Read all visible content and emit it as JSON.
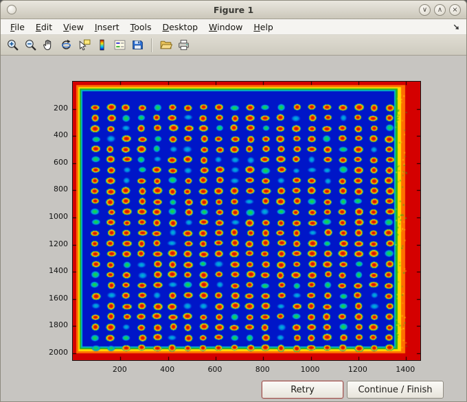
{
  "window": {
    "title": "Figure 1",
    "controls": [
      {
        "name": "minimize",
        "glyph": "∨"
      },
      {
        "name": "maximize",
        "glyph": "∧"
      },
      {
        "name": "close",
        "glyph": "×"
      }
    ]
  },
  "menubar": {
    "items": [
      {
        "label": "File"
      },
      {
        "label": "Edit"
      },
      {
        "label": "View"
      },
      {
        "label": "Insert"
      },
      {
        "label": "Tools"
      },
      {
        "label": "Desktop"
      },
      {
        "label": "Window"
      },
      {
        "label": "Help"
      }
    ]
  },
  "toolbar": {
    "buttons": [
      {
        "name": "zoom-in",
        "title": "Zoom In"
      },
      {
        "name": "zoom-out",
        "title": "Zoom Out"
      },
      {
        "name": "pan",
        "title": "Pan"
      },
      {
        "name": "rotate-3d",
        "title": "Rotate 3D"
      },
      {
        "name": "data-cursor",
        "title": "Data Cursor"
      },
      {
        "name": "insert-colorbar",
        "title": "Insert Colorbar"
      },
      {
        "name": "insert-legend",
        "title": "Insert Legend"
      },
      {
        "name": "save-figure",
        "title": "Save Figure"
      },
      {
        "name": "open-file",
        "title": "Open File"
      },
      {
        "name": "print-figure",
        "title": "Print Figure"
      }
    ]
  },
  "actions": {
    "retry_label": "Retry",
    "continue_label": "Continue / Finish"
  },
  "chart_data": {
    "type": "heatmap",
    "title": "",
    "xlabel": "",
    "ylabel": "",
    "colormap": "jet",
    "description": "Microarray plate scan rendered with jet colormap: 24 x 20 grid of red/orange spots with yellow-green halos on a deep blue field; bright red/orange illumination artifacts along all four image edges, widest on the right side with a speckled yellow-green band inside it",
    "x_range": [
      0,
      1460
    ],
    "y_range": [
      0,
      2050
    ],
    "x_ticks": [
      200,
      400,
      600,
      800,
      1000,
      1200,
      1400
    ],
    "y_ticks": [
      200,
      400,
      600,
      800,
      1000,
      1200,
      1400,
      1600,
      1800,
      2000
    ],
    "spot_grid": {
      "rows": 24,
      "cols": 20,
      "x_start": 95,
      "y_start": 190,
      "x_step": 65,
      "y_step": 77
    },
    "palette": {
      "field": "#0016c8",
      "edge": [
        "#d40000",
        "#ff7000",
        "#ffdc00",
        "#2cb41e",
        "#00b4c8"
      ],
      "spot_core": "#c80a00",
      "spot_halo": "#ffe400",
      "spot_rim": "#35b41e"
    }
  }
}
